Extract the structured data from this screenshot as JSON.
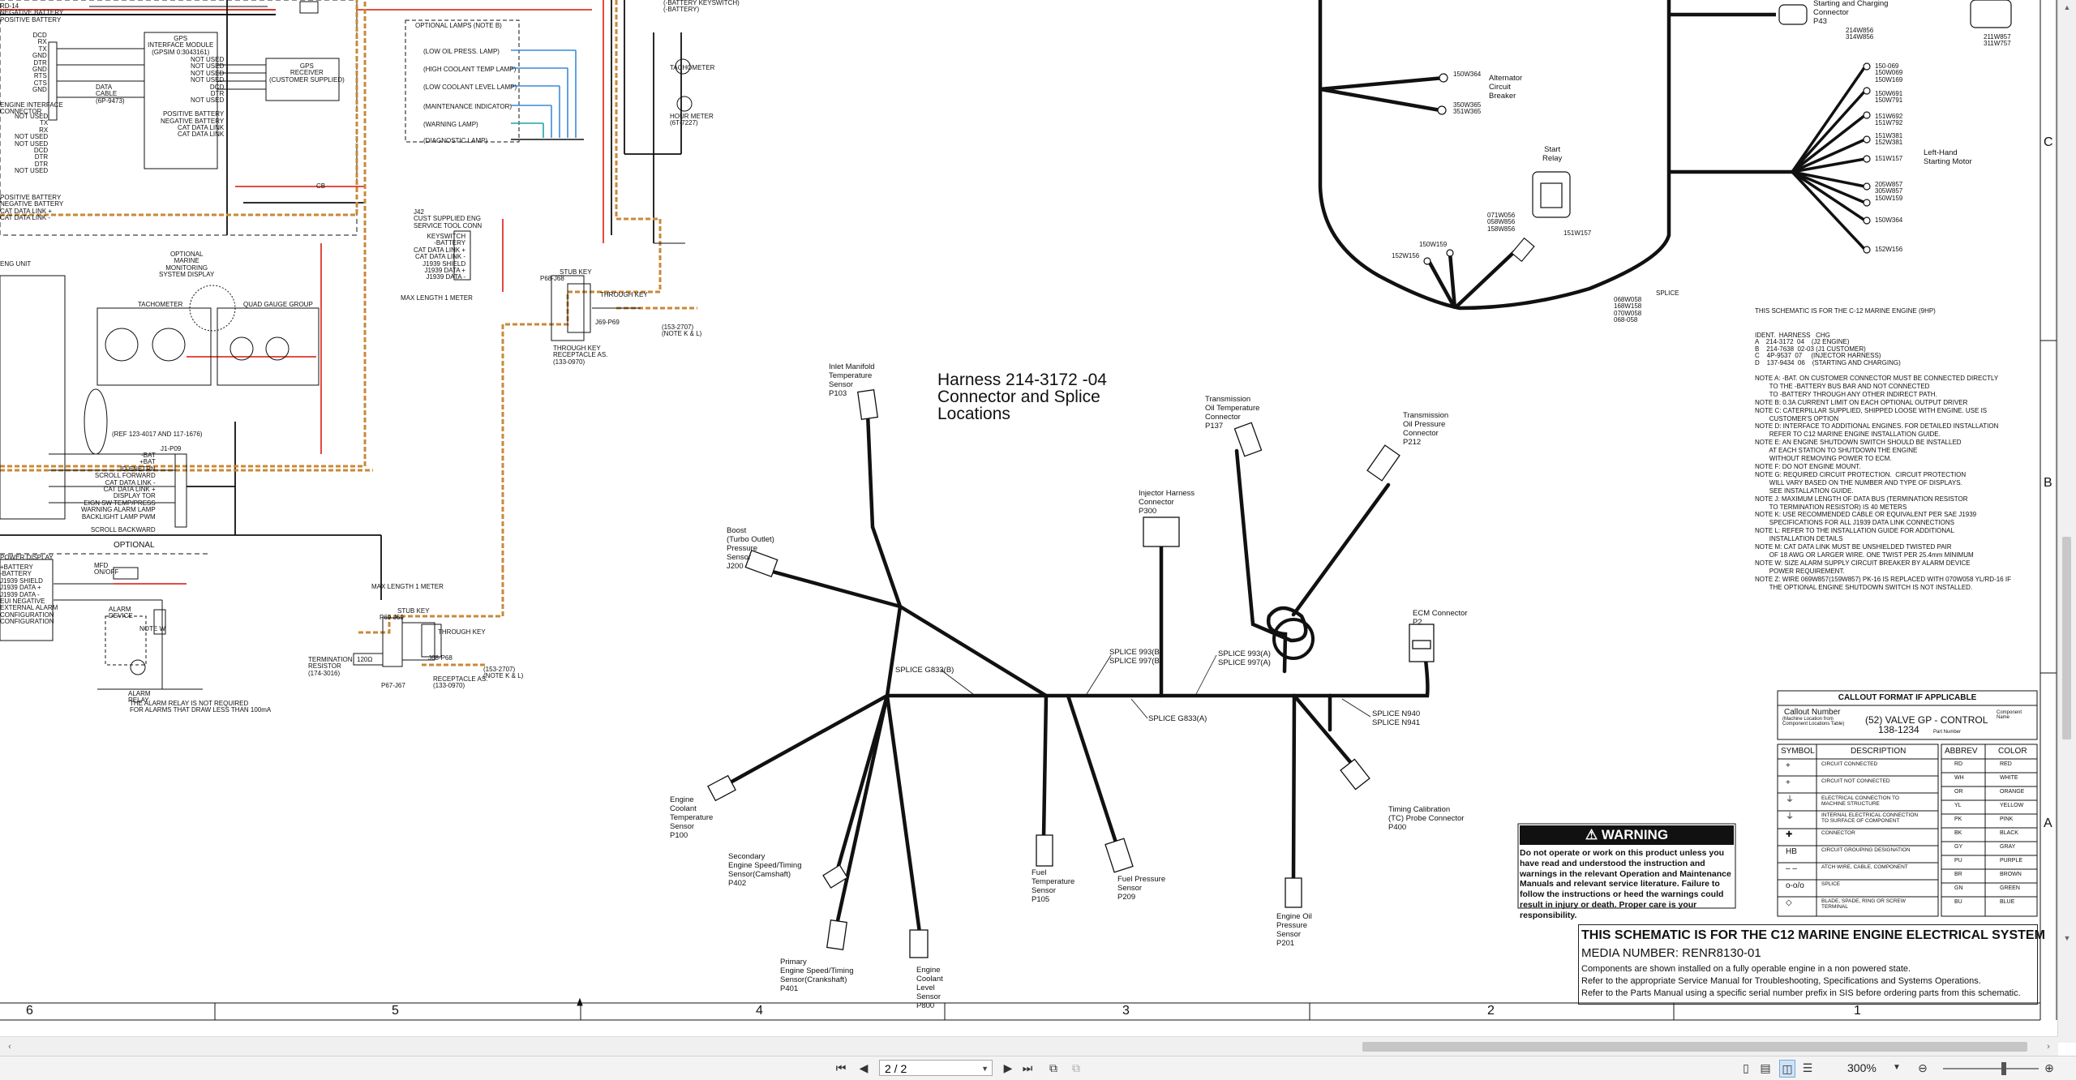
{
  "diagram": {
    "title_lines": [
      "Harness 214-3172 -04",
      "Connector and Splice",
      "Locations"
    ],
    "connectors": [
      {
        "id": "p103",
        "label": "Inlet Manifold\nTemperature\nSensor\nP103"
      },
      {
        "id": "j200",
        "label": "Boost\n(Turbo Outlet)\nPressure\nSensor\nJ200"
      },
      {
        "id": "p300",
        "label": "Injector Harness\nConnector\nP300"
      },
      {
        "id": "p137",
        "label": "Transmission\nOil Temperature\nConnector\nP137"
      },
      {
        "id": "p212",
        "label": "Transmission\nOil Pressure\nConnector\nP212"
      },
      {
        "id": "p2",
        "label": "ECM Connector\nP2"
      },
      {
        "id": "p100",
        "label": "Engine\nCoolant\nTemperature\nSensor\nP100"
      },
      {
        "id": "p402",
        "label": "Secondary\nEngine Speed/Timing\nSensor(Camshaft)\nP402"
      },
      {
        "id": "p401",
        "label": "Primary\nEngine Speed/Timing\nSensor(Crankshaft)\nP401"
      },
      {
        "id": "p800",
        "label": "Engine\nCoolant\nLevel\nSensor\nP800"
      },
      {
        "id": "p105",
        "label": "Fuel\nTemperature\nSensor\nP105"
      },
      {
        "id": "p209",
        "label": "Fuel Pressure\nSensor\nP209"
      },
      {
        "id": "p201",
        "label": "Engine Oil\nPressure\nSensor\nP201"
      },
      {
        "id": "p400",
        "label": "Timing Calibration\n(TC) Probe Connector\nP400"
      }
    ],
    "splices": [
      {
        "id": "g833b",
        "label": "SPLICE G833(B)"
      },
      {
        "id": "g833a",
        "label": "SPLICE G833(A)"
      },
      {
        "id": "s993b",
        "label": "SPLICE 993(B)\nSPLICE 997(B)"
      },
      {
        "id": "s993a",
        "label": "SPLICE 993(A)\nSPLICE 997(A)"
      },
      {
        "id": "n940",
        "label": "SPLICE N940\nSPLICE N941"
      }
    ],
    "alternator": {
      "label": "Alternator\nCircuit\nBreaker",
      "wires": [
        "150W364",
        "350W365\n351W365"
      ]
    },
    "start_relay": {
      "label": "Start\nRelay",
      "wires": [
        "071W056\n058W856\n158W856",
        "151W157",
        "150W159",
        "152W156"
      ]
    },
    "splice_right": {
      "label": "SPLICE",
      "wires": "068W058\n168W158\n070W058\n068-058"
    },
    "starter": {
      "label": "Left-Hand\nStarting Motor",
      "wires": [
        "150-069\n150W069\n150W169",
        "150W691\n150W791",
        "151W692\n151W792",
        "151W381\n152W381",
        "151W157",
        "205W857\n305W857\n150W159",
        "150W364",
        "152W156"
      ]
    },
    "charging": {
      "label": "Starting and Charging\nConnector\nP43",
      "wires": "214W856\n314W856",
      "right": "211W857\n311W757"
    },
    "right_notes": {
      "intro": "THIS SCHEMATIC IS FOR THE C-12 MARINE ENGINE (9HP)",
      "ident": "IDENT.  HARNESS   CHG\nA    214-3172  04    (J2 ENGINE)\nB    214-7638  02-03 (J1 CUSTOMER)\nC    4P-9537  07     (INJECTOR HARNESS)\nD    137-9434  06    (STARTING AND CHARGING)",
      "notes": "NOTE A: -BAT. ON CUSTOMER CONNECTOR MUST BE CONNECTED DIRECTLY\n        TO THE -BATTERY BUS BAR AND NOT CONNECTED\n        TO -BATTERY THROUGH ANY OTHER INDIRECT PATH.\nNOTE B: 0.3A CURRENT LIMIT ON EACH OPTIONAL OUTPUT DRIVER\nNOTE C: CATERPILLAR SUPPLIED, SHIPPED LOOSE WITH ENGINE. USE IS\n        CUSTOMER'S OPTION\nNOTE D: INTERFACE TO ADDITIONAL ENGINES. FOR DETAILED INSTALLATION\n        REFER TO C12 MARINE ENGINE INSTALLATION GUIDE.\nNOTE E: AN ENGINE SHUTDOWN SWITCH SHOULD BE INSTALLED\n        AT EACH STATION TO SHUTDOWN THE ENGINE\n        WITHOUT REMOVING POWER TO ECM.\nNOTE F: DO NOT ENGINE MOUNT.\nNOTE G: REQUIRED CIRCUIT PROTECTION.  CIRCUIT PROTECTION\n        WILL VARY BASED ON THE NUMBER AND TYPE OF DISPLAYS.\n        SEE INSTALLATION GUIDE.\nNOTE J: MAXIMUM LENGTH OF DATA BUS (TERMINATION RESISTOR\n        TO TERMINATION RESISTOR) IS 40 METERS\nNOTE K: USE RECOMMENDED CABLE OR EQUIVALENT PER SAE J1939\n        SPECIFICATIONS FOR ALL J1939 DATA LINK CONNECTIONS\nNOTE L: REFER TO THE INSTALLATION GUIDE FOR ADDITIONAL\n        INSTALLATION DETAILS\nNOTE M: CAT DATA LINK MUST BE UNSHIELDED TWISTED PAIR\n        OF 18 AWG OR LARGER WIRE. ONE TWIST PER 25.4mm MINIMUM\nNOTE W: SIZE ALARM SUPPLY CIRCUIT BREAKER BY ALARM DEVICE\n        POWER REQUIREMENT.\nNOTE Z: WIRE 069W857(159W857) PK-16 IS REPLACED WITH 070W058 YL/RD-16 IF\n        THE OPTIONAL ENGINE SHUTDOWN SWITCH IS NOT INSTALLED."
    },
    "callout": {
      "title": "CALLOUT FORMAT IF APPLICABLE",
      "callout_number": "Callout Number",
      "callout_sub": "(Machine Location from\nComponent Locations Table)",
      "example": "(52) VALVE GP - CONTROL",
      "part": "138-1234",
      "component_name": "Component\nName",
      "part_number": "Part Number"
    },
    "legend": {
      "headers": [
        "SYMBOL",
        "DESCRIPTION"
      ],
      "rows": [
        {
          "sym": "+",
          "desc": "CIRCUIT CONNECTED"
        },
        {
          "sym": "+",
          "desc": "CIRCUIT NOT CONNECTED"
        },
        {
          "sym": "⏚",
          "desc": "ELECTRICAL CONNECTION TO\nMACHINE STRUCTURE"
        },
        {
          "sym": "⏚",
          "desc": "INTERNAL ELECTRICAL CONNECTION\nTO SURFACE OF COMPONENT"
        },
        {
          "sym": "✚",
          "desc": "CONNECTOR"
        },
        {
          "sym": "HB",
          "desc": "CIRCUIT GROUPING DESIGNATION"
        },
        {
          "sym": "– –",
          "desc": "ATCH WIRE, CABLE, COMPONENT"
        },
        {
          "sym": "o-o/o",
          "desc": "SPLICE"
        },
        {
          "sym": "◇",
          "desc": "BLADE, SPADE, RING OR SCREW\nTERMINAL"
        }
      ]
    },
    "colors": {
      "headers": [
        "ABBREV",
        "COLOR"
      ],
      "rows": [
        [
          "RD",
          "RED"
        ],
        [
          "WH",
          "WHITE"
        ],
        [
          "OR",
          "ORANGE"
        ],
        [
          "YL",
          "YELLOW"
        ],
        [
          "PK",
          "PINK"
        ],
        [
          "BK",
          "BLACK"
        ],
        [
          "GY",
          "GRAY"
        ],
        [
          "PU",
          "PURPLE"
        ],
        [
          "BR",
          "BROWN"
        ],
        [
          "GN",
          "GREEN"
        ],
        [
          "BU",
          "BLUE"
        ]
      ]
    },
    "warning": {
      "heading": "WARNING",
      "body": "Do not operate or work on this product unless you have read and understood the instruction and warnings in the relevant Operation and Maintenance Manuals and relevant service literature. Failure to follow the instructions or heed the warnings could result in injury or death. Proper care is your responsibility."
    },
    "title_block": {
      "title": "THIS SCHEMATIC IS FOR THE C12 MARINE ENGINE ELECTRICAL SYSTEM",
      "media": "MEDIA NUMBER: RENR8130-01",
      "lines": [
        "Components are shown installed on a fully operable engine in a non powered state.",
        "Refer to the appropriate Service Manual for Troubleshooting, Specifications and Systems Operations.",
        "Refer to the Parts Manual using a specific serial number prefix in SIS before ordering parts from this schematic."
      ]
    },
    "zones": {
      "columns": [
        "6",
        "5",
        "4",
        "3",
        "2",
        "1"
      ],
      "rows": [
        "C",
        "B",
        "A"
      ]
    },
    "left_panel": {
      "gps_module": "GPS\nINTERFACE MODULE\n(GPSIM 0:3043161)",
      "gps_receiver": "GPS\nRECEIVER\n(CUSTOMER SUPPLIED)",
      "optional_lamps": "OPTIONAL LAMPS (NOTE B)",
      "lamps": [
        "(LOW OIL PRESS. LAMP)",
        "(HIGH COOLANT TEMP LAMP)",
        "(LOW COOLANT LEVEL LAMP)",
        "(MAINTENANCE INDICATOR)",
        "(WARNING LAMP)",
        "(DIAGNOSTIC LAMP)"
      ],
      "tachometer_top": "TACHOMETER",
      "hour_meter": "HOUR METER\n(6T-7227)",
      "j42": "J42\nCUST SUPPLIED ENG\nSERVICE TOOL CONN",
      "j42_pins": "KEYSWITCH\n-BATTERY\nCAT DATA LINK +\nCAT DATA LINK -\nJ1939 SHIELD\nJ1939 DATA +\nJ1939 DATA -",
      "max_length": "MAX LENGTH 1 METER",
      "stub_key": "STUB KEY",
      "through_key": "THROUGH KEY",
      "receptacle": "THROUGH KEY\nRECEPTACLE AS.\n(133-0970)",
      "note_k": "(153-2707)\n(NOTE K & L)",
      "msd": "OPTIONAL\nMARINE\nMONITORING\nSYSTEM DISPLAY",
      "tach2": "TACHOMETER",
      "quad": "QUAD GAUGE GROUP",
      "ref": "(REF 123-4017 AND 117-1676)",
      "j1p09": "J1-P09",
      "j1_pins": "-BAT\n+BAT\nID-ENETRN\nSCROLL FORWARD\nCAT DATA LINK -\nCAT DATA LINK +\nDISPLAY TOR\nEIGN SW TEMP/PRESS\nWARNING ALARM LAMP\nBACKLIGHT LAMP PWM\n\nSCROLL BACKWARD",
      "optional": "OPTIONAL",
      "power_display": "POWER DISPLAY",
      "left_pins": "+BATTERY\n-BATTERY\nJ1939 SHIELD\nJ1939 DATA +\nJ1939 DATA -\nEUI NEGATIVE\nEXTERNAL ALARM\nCONFIGURATION\nCONFIGURATION",
      "mfd": "MFD\nON/OFF",
      "alarm_device": "ALARM\nDEVICE",
      "note_w": "NOTE W",
      "alarm_relay": "ALARM\nRELAY",
      "alarm_note": "THE ALARM RELAY IS NOT REQUIRED\nFOR ALARMS THAT DRAW LESS THAN 100mA",
      "termination": "TERMINATION\nRESISTOR\n(174-3016)",
      "max_length_2": "MAX LENGTH 1 METER",
      "stub_key_2": "STUB KEY",
      "through_key_2": "THROUGH KEY",
      "receptacle_2": "RECEPTACLE AS.\n(133-0970)",
      "note_k2": "(153-2707)\n(NOTE K & L)",
      "top_left_pins": "RD-14\nNEGATIVE BATTERY\nPOSITIVE BATTERY",
      "battery_keyswitch": "(-BATTERY KEYSWITCH)\n(-BATTERY)",
      "gps_left": "DCD\nRX\nTX\nGND\nDTR\nGND\nRTS\nCTS\nGND",
      "data_cable": "DATA\nCABLE\n(6P-9473)",
      "gps_pins": "NOT USED\nNOT USED\nNOT USED\nNOT USED\nDCD\nDTR\nNOT USED\n\nPOSITIVE BATTERY\nNEGATIVE BATTERY\nCAT DATA LINK\nCAT DATA LINK",
      "side_pins": "NOT USED\nTX\nRX\nNOT USED\nNOT USED\nDCD\nDTR\nDTR\nNOT USED",
      "side_pins_b": "POSITIVE BATTERY\nNEGATIVE BATTERY\nCAT DATA LINK +\nCAT DATA LINK -",
      "left_edge": "ENGINE INTERFACE\nCONNECTOR",
      "ecu_unit": "ENG UNIT",
      "cb": "CB",
      "p69": "P69-J69",
      "p68": "P68-J68",
      "p67": "P67-J67",
      "j68p68": "J68-P68",
      "j69p69": "J69-P69",
      "res": "120Ω"
    }
  },
  "viewer": {
    "page_value": "2 / 2",
    "zoom": "300%",
    "first_icon": "first-page-icon",
    "prev_icon": "prev-page-icon",
    "next_icon": "next-page-icon",
    "last_icon": "last-page-icon",
    "wire_colors": {
      "red": "#e0352b",
      "orange": "#c8893a",
      "blue": "#3a8bd6",
      "teal": "#20a3a8",
      "black": "#111111"
    }
  }
}
